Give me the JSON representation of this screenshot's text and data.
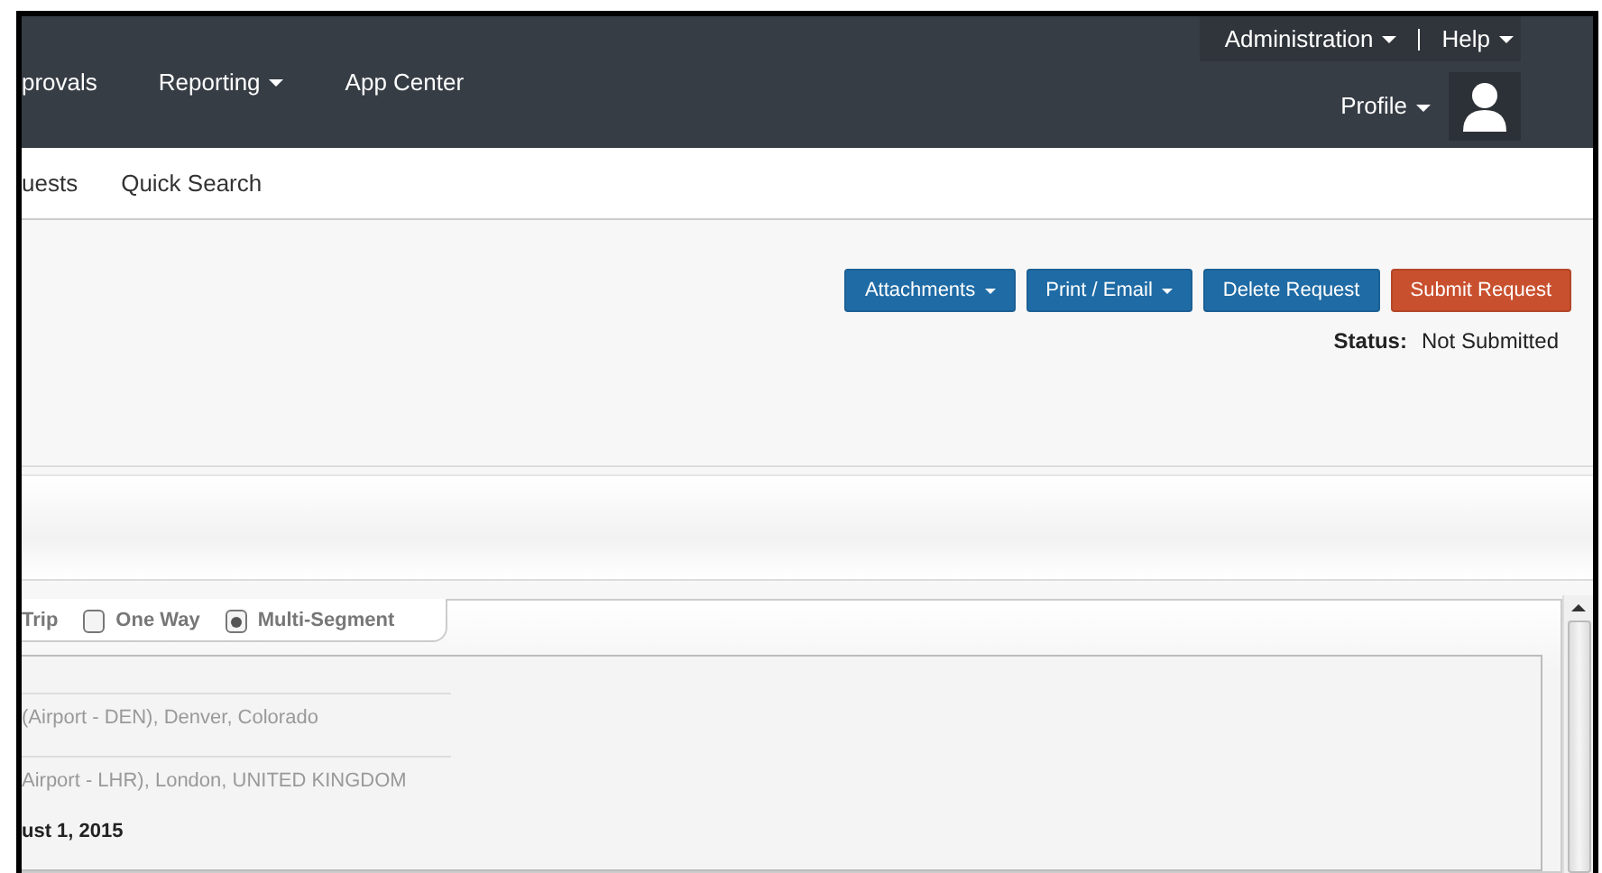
{
  "top_nav": {
    "utility_links": [
      {
        "label": "Administration",
        "dropdown": true
      },
      {
        "label": "Help",
        "dropdown": true
      }
    ],
    "main_links": [
      {
        "label": "provals",
        "dropdown": false
      },
      {
        "label": "Reporting",
        "dropdown": true
      },
      {
        "label": "App Center",
        "dropdown": false
      }
    ],
    "profile": {
      "label": "Profile"
    }
  },
  "sub_nav": [
    "uests",
    "Quick Search"
  ],
  "actions": [
    {
      "label": "Attachments",
      "dropdown": true,
      "kind": "primary"
    },
    {
      "label": "Print / Email",
      "dropdown": true,
      "kind": "primary"
    },
    {
      "label": "Delete Request",
      "dropdown": false,
      "kind": "primary"
    },
    {
      "label": "Submit Request",
      "dropdown": false,
      "kind": "danger"
    }
  ],
  "status": {
    "label": "Status:",
    "value": "Not Submitted"
  },
  "trip_type": [
    {
      "label": "Trip",
      "kind": "text"
    },
    {
      "label": "One Way",
      "kind": "radio",
      "selected": false
    },
    {
      "label": "Multi-Segment",
      "kind": "radio",
      "selected": true
    }
  ],
  "segment_lines": [
    "(Airport - DEN), Denver, Colorado",
    "Airport - LHR), London, UNITED KINGDOM"
  ],
  "date_text": "ust 1, 2015"
}
